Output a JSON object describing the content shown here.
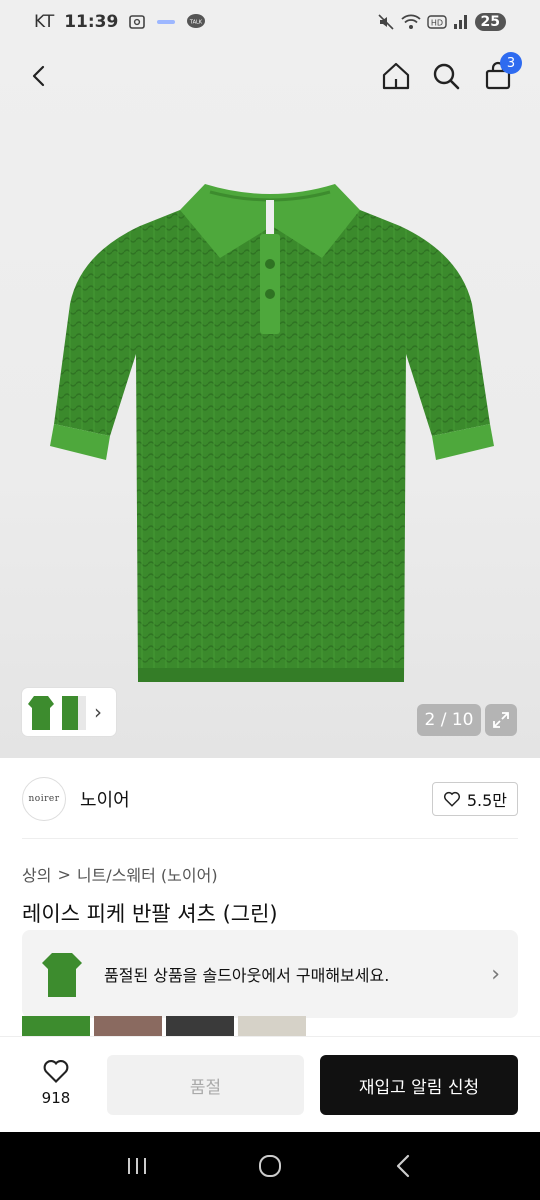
{
  "status_bar": {
    "carrier": "KT",
    "time": "11:39",
    "talk_label": "TALK",
    "battery": "25"
  },
  "nav": {
    "cart_count": "3"
  },
  "gallery": {
    "counter": "2 / 10",
    "image_color": "#3d8c2e"
  },
  "brand": {
    "logo_text": "noirer",
    "name": "노이어",
    "likes": "5.5만"
  },
  "breadcrumb": {
    "category": "상의",
    "separator": ">",
    "subcategory": "니트/스웨터 (노이어)"
  },
  "product": {
    "title": "레이스 피케 반팔 셔츠 (그린)"
  },
  "banner": {
    "text": "품절된 상품을 솔드아웃에서 구매해보세요."
  },
  "actions": {
    "wish_count": "918",
    "soldout_label": "품절",
    "restock_label": "재입고 알림 신청"
  },
  "colors": {
    "accent_blue": "#2e6bf0",
    "primary_button": "#111111"
  }
}
